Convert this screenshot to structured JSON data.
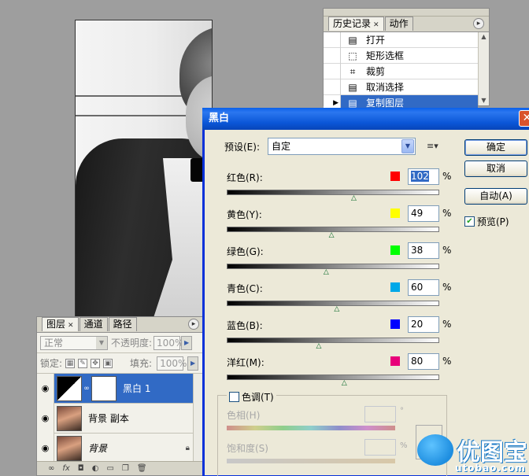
{
  "history": {
    "tabs": [
      {
        "label": "历史记录"
      },
      {
        "label": "动作"
      }
    ],
    "items": [
      {
        "label": "打开",
        "icon": "doc-icon"
      },
      {
        "label": "矩形选框",
        "icon": "marquee-icon"
      },
      {
        "label": "裁剪",
        "icon": "crop-icon"
      },
      {
        "label": "取消选择",
        "icon": "doc-icon"
      },
      {
        "label": "复制图层",
        "icon": "doc-icon",
        "selected": true
      }
    ]
  },
  "layers": {
    "tabs": [
      {
        "label": "图层"
      },
      {
        "label": "通道"
      },
      {
        "label": "路径"
      }
    ],
    "blend_mode": "正常",
    "opacity_label": "不透明度:",
    "opacity_value": "100%",
    "lock_label": "锁定:",
    "fill_label": "填充:",
    "fill_value": "100%",
    "items": [
      {
        "name": "黑白 1",
        "selected": true
      },
      {
        "name": "背景 副本"
      },
      {
        "name": "背景"
      }
    ]
  },
  "dialog": {
    "title": "黑白",
    "preset_label": "预设(E):",
    "preset_value": "自定",
    "sliders": [
      {
        "label": "红色(R):",
        "value": "102",
        "color": "#ff0000",
        "thumb_pos": 0.6
      },
      {
        "label": "黄色(Y):",
        "value": "49",
        "color": "#ffff00",
        "thumb_pos": 0.495
      },
      {
        "label": "绿色(G):",
        "value": "38",
        "color": "#00ff00",
        "thumb_pos": 0.47
      },
      {
        "label": "青色(C):",
        "value": "60",
        "color": "#00a8e8",
        "thumb_pos": 0.52
      },
      {
        "label": "蓝色(B):",
        "value": "20",
        "color": "#0000ff",
        "thumb_pos": 0.435
      },
      {
        "label": "洋红(M):",
        "value": "80",
        "color": "#e8007a",
        "thumb_pos": 0.555
      }
    ],
    "percent": "%",
    "buttons": {
      "ok": "确定",
      "cancel": "取消",
      "auto": "自动(A)"
    },
    "preview_label": "预览(P)",
    "tint_label": "色调(T)",
    "hue_label": "色相(H)",
    "hue_unit": "°",
    "saturation_label": "饱和度(S)",
    "saturation_unit": "%"
  },
  "watermark": {
    "text": "优图宝",
    "url": "utobao.com"
  }
}
